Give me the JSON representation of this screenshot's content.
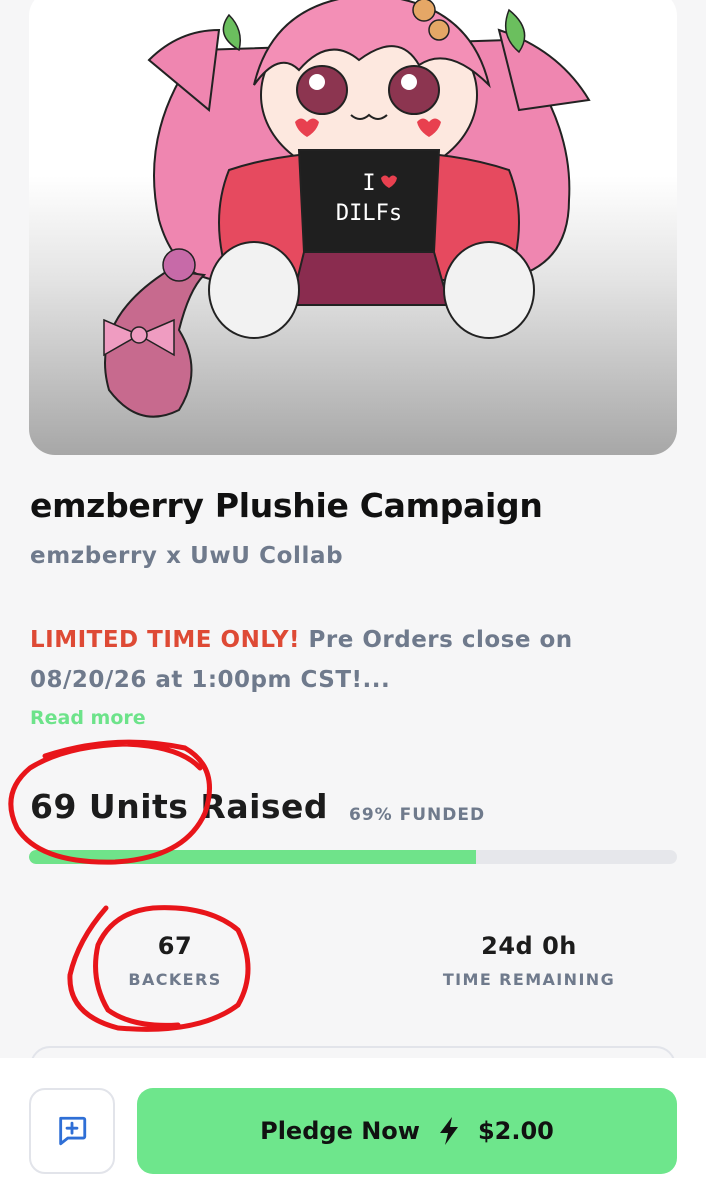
{
  "campaign": {
    "title": "emzberry Plushie Campaign",
    "subtitle": "emzberry x UwU Collab",
    "description_urgent": "LIMITED TIME ONLY!",
    "description_rest": " Pre Orders close on 08/20/26 at 1:00pm CST!...",
    "read_more_label": "Read more",
    "shirt_text_top": "I",
    "shirt_text_bottom": "DILFs"
  },
  "funding": {
    "raised_label": "69 Units Raised",
    "funded_label": "69% FUNDED",
    "funded_fraction": 0.69
  },
  "stats": {
    "backers_value": "67",
    "backers_label": "BACKERS",
    "time_value": "24d 0h",
    "time_label": "TIME REMAINING"
  },
  "actions": {
    "chat_icon": "message-plus-icon",
    "pledge_label": "Pledge Now",
    "pledge_icon": "lightning-icon",
    "pledge_price": "$2.00"
  },
  "colors": {
    "accent_green": "#6ee68c",
    "urgent_red": "#de4a35",
    "muted_text": "#6f7a8c",
    "annotation_red": "#e8151a"
  }
}
